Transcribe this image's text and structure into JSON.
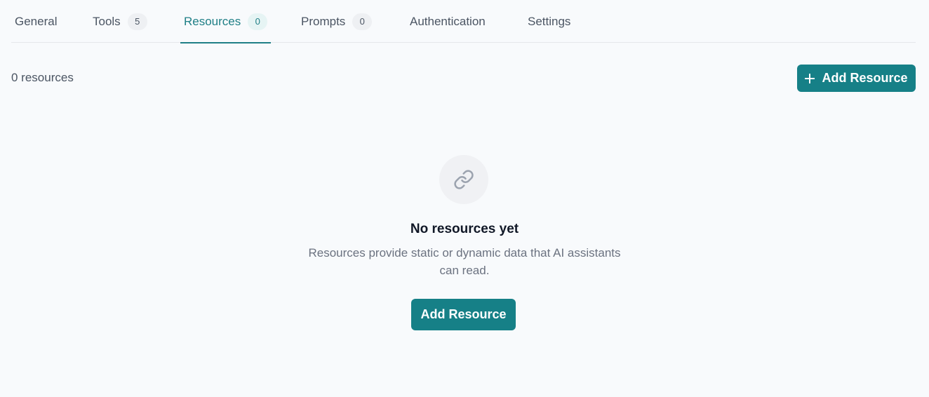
{
  "tabs": [
    {
      "label": "General",
      "badge": null
    },
    {
      "label": "Tools",
      "badge": "5"
    },
    {
      "label": "Resources",
      "badge": "0",
      "active": true
    },
    {
      "label": "Prompts",
      "badge": "0"
    },
    {
      "label": "Authentication",
      "badge": null
    },
    {
      "label": "Settings",
      "badge": null
    }
  ],
  "toolbar": {
    "count_text": "0 resources",
    "add_label": "Add Resource",
    "add_icon": "plus-icon"
  },
  "empty_state": {
    "icon": "link-icon",
    "title": "No resources yet",
    "description_line1": "Resources provide static or dynamic data that AI assistants",
    "description_line2": "can read.",
    "button_label": "Add Resource"
  },
  "colors": {
    "accent": "#168087",
    "active_tab": "#1f7f86",
    "background": "#f8fafc"
  }
}
